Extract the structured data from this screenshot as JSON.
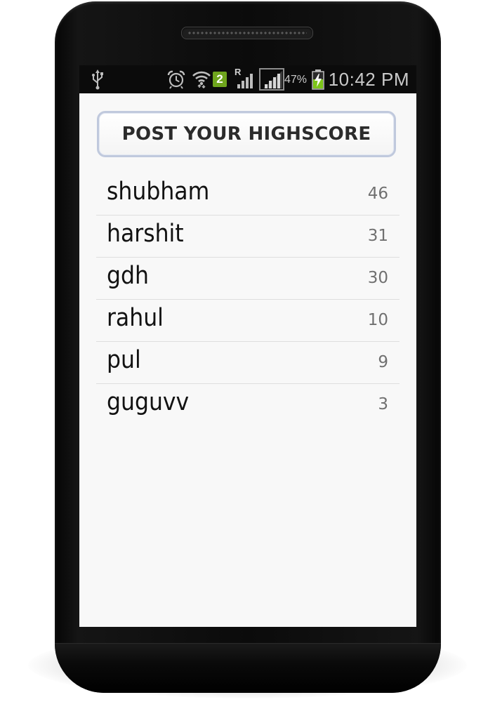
{
  "status_bar": {
    "icons": [
      "usb-icon",
      "alarm-icon",
      "wifi-icon",
      "sim-2-icon",
      "roaming-signal-icon",
      "signal-icon",
      "battery-charging-icon"
    ],
    "sim_badge": "2",
    "roaming_label": "R",
    "battery_percent": "47%",
    "time": "10:42 PM",
    "colors": {
      "sim_badge": "#6fa51d",
      "battery_fill": "#7dc51a"
    }
  },
  "main": {
    "post_button_label": "POST YOUR HIGHSCORE",
    "scores": [
      {
        "name": "shubham",
        "score": "46"
      },
      {
        "name": "harshit",
        "score": "31"
      },
      {
        "name": "gdh",
        "score": "30"
      },
      {
        "name": "rahul",
        "score": "10"
      },
      {
        "name": "pul",
        "score": "9"
      },
      {
        "name": "guguvv",
        "score": "3"
      }
    ]
  }
}
